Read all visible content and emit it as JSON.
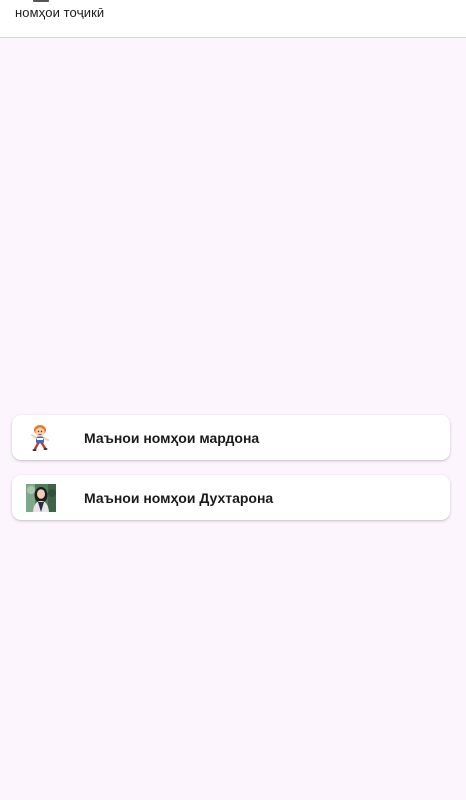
{
  "app_bar": {
    "title": "номҳои тоҷикӣ"
  },
  "menu": {
    "items": [
      {
        "label": "Маънои номҳои мардона",
        "icon": "boy-cartoon-icon"
      },
      {
        "label": "Маънои номҳои Духтарона",
        "icon": "girl-photo-icon"
      }
    ]
  },
  "colors": {
    "background": "#fcf5fd",
    "card": "#ffffff",
    "app_bar": "#ffffff"
  }
}
